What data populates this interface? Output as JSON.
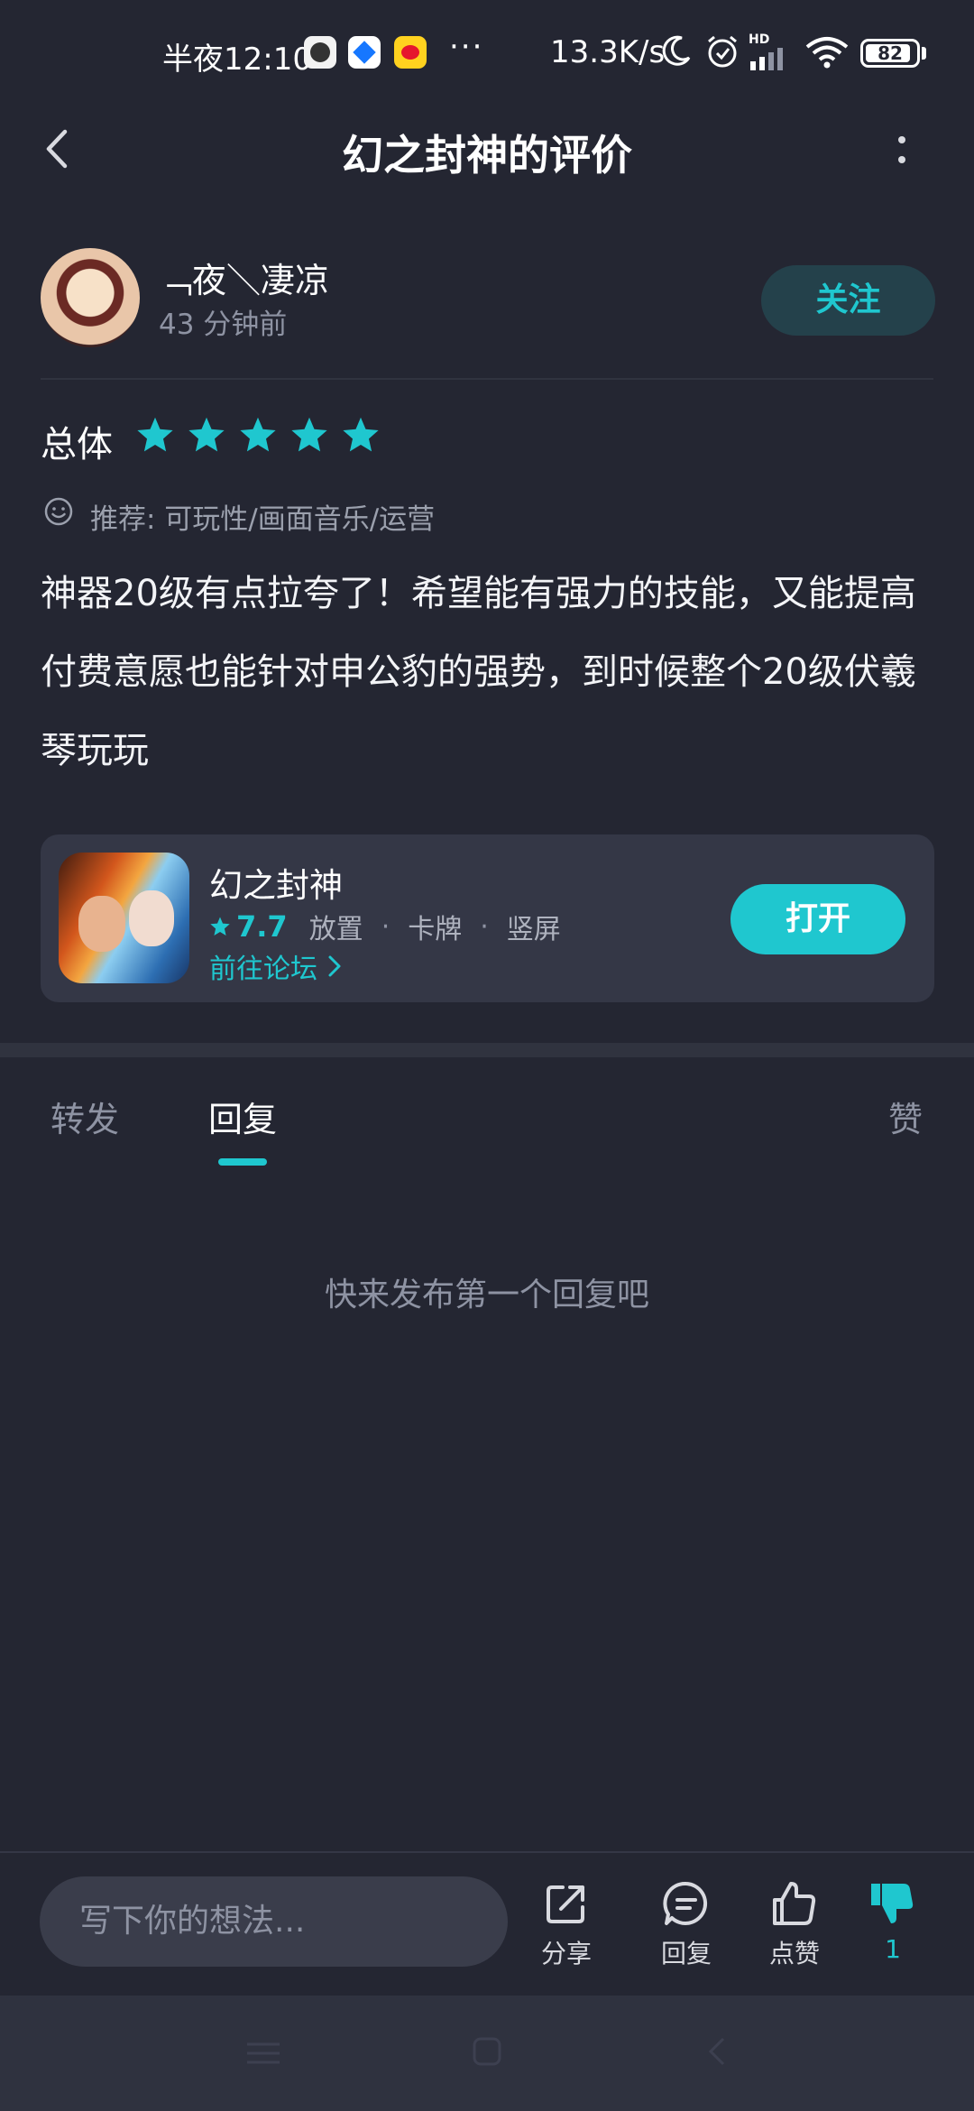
{
  "status_bar": {
    "time": "半夜12:10",
    "more": "···",
    "network_speed": "13.3K/s",
    "signal_label": "HD",
    "battery": "82"
  },
  "header": {
    "title": "幻之封神的评价"
  },
  "review": {
    "author": "﹁夜＼凄凉",
    "time_ago": "43 分钟前",
    "follow_label": "关注",
    "overall_label": "总体",
    "rating": 5,
    "recommend": "推荐: 可玩性/画面音乐/运营",
    "body": "神器20级有点拉夸了！希望能有强力的技能，又能提高付费意愿也能针对申公豹的强势，到时候整个20级伏羲琴玩玩"
  },
  "game_card": {
    "name": "幻之封神",
    "score": "7.7",
    "tags": [
      "放置",
      "卡牌",
      "竖屏"
    ],
    "forum_link": "前往论坛",
    "open_label": "打开"
  },
  "tabs": {
    "forward": "转发",
    "reply": "回复",
    "like": "赞"
  },
  "empty_state": "快来发布第一个回复吧",
  "bottom_bar": {
    "input_placeholder": "写下你的想法...",
    "share": "分享",
    "reply": "回复",
    "like": "点赞",
    "dislike_count": "1"
  },
  "colors": {
    "background": "#242632",
    "accent": "#1fc7cf",
    "card": "#343746"
  }
}
